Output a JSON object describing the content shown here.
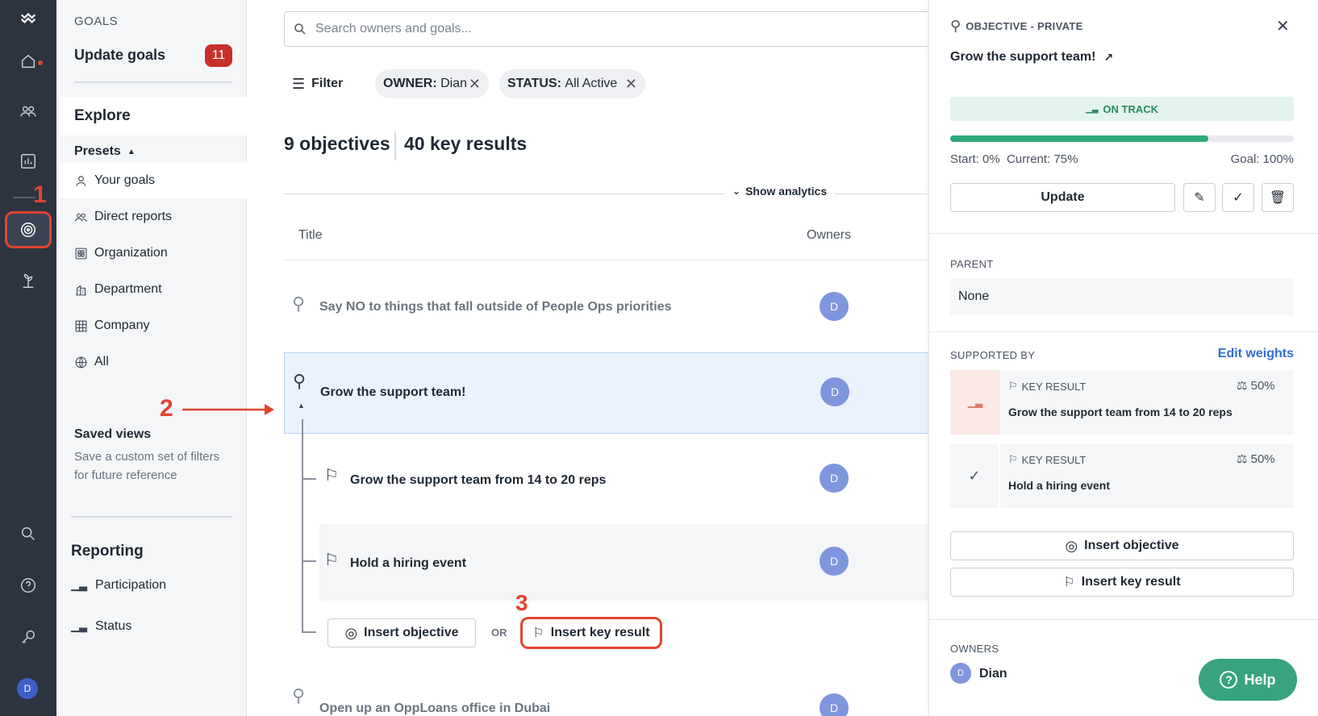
{
  "rail": {
    "icons": [
      "logo-icon",
      "home-icon",
      "people-icon",
      "chart-icon",
      "goals-icon",
      "growth-icon",
      "search-icon",
      "help-icon",
      "key-icon"
    ],
    "avatar": "D"
  },
  "side": {
    "section": "GOALS",
    "update_label": "Update goals",
    "update_count": "11",
    "explore": "Explore",
    "presets": "Presets",
    "preset_items": [
      "Your goals",
      "Direct reports",
      "Organization",
      "Department",
      "Company",
      "All"
    ],
    "saved_title": "Saved views",
    "saved_desc": "Save a custom set of filters for future reference",
    "reporting": "Reporting",
    "reporting_items": [
      "Participation",
      "Status"
    ]
  },
  "main": {
    "search_placeholder": "Search owners and goals...",
    "filter_label": "Filter",
    "chips": [
      {
        "key": "OWNER:",
        "value": "Dian"
      },
      {
        "key": "STATUS:",
        "value": "All Active"
      }
    ],
    "objectives_count": "9 objectives",
    "kr_count": "40 key results",
    "show_analytics": "Show analytics",
    "col_title": "Title",
    "col_owners": "Owners",
    "rows": [
      {
        "title": "Say NO to things that fall outside of People Ops priorities",
        "owner": "D"
      },
      {
        "title": "Grow the support team!",
        "owner": "D"
      },
      {
        "title": "Grow the support team from 14 to 20 reps",
        "owner": "D"
      },
      {
        "title": "Hold a hiring event",
        "owner": "D"
      },
      {
        "title": "Open up an OppLoans office in Dubai",
        "owner": "D"
      }
    ],
    "insert_objective": "Insert objective",
    "or": "OR",
    "insert_kr": "Insert key result"
  },
  "annotations": [
    "1",
    "2",
    "3"
  ],
  "panel": {
    "type": "OBJECTIVE - PRIVATE",
    "title": "Grow the support team!",
    "status": "ON TRACK",
    "progress": 0.75,
    "start": "Start: 0%",
    "current": "Current: 75%",
    "goal": "Goal: 100%",
    "update": "Update",
    "parent_label": "PARENT",
    "parent_value": "None",
    "supported_label": "SUPPORTED BY",
    "edit_weights": "Edit weights",
    "key_results": [
      {
        "kind": "KEY RESULT",
        "weight": "50%",
        "title": "Grow the support team from 14 to 20 reps"
      },
      {
        "kind": "KEY RESULT",
        "weight": "50%",
        "title": "Hold a hiring event"
      }
    ],
    "insert_objective": "Insert objective",
    "insert_kr": "Insert key result",
    "owners_label": "OWNERS",
    "owner_avatar": "D",
    "owner_name": "Dian",
    "help": "Help"
  },
  "colors": {
    "accent": "#2f6fd3",
    "rail": "#2c3440",
    "status_bg": "#e3f4ee",
    "status_fg": "#2b8a5f",
    "progress": "#2eaa7c",
    "help_bg": "#38a37c",
    "annotation": "#e0442f"
  }
}
